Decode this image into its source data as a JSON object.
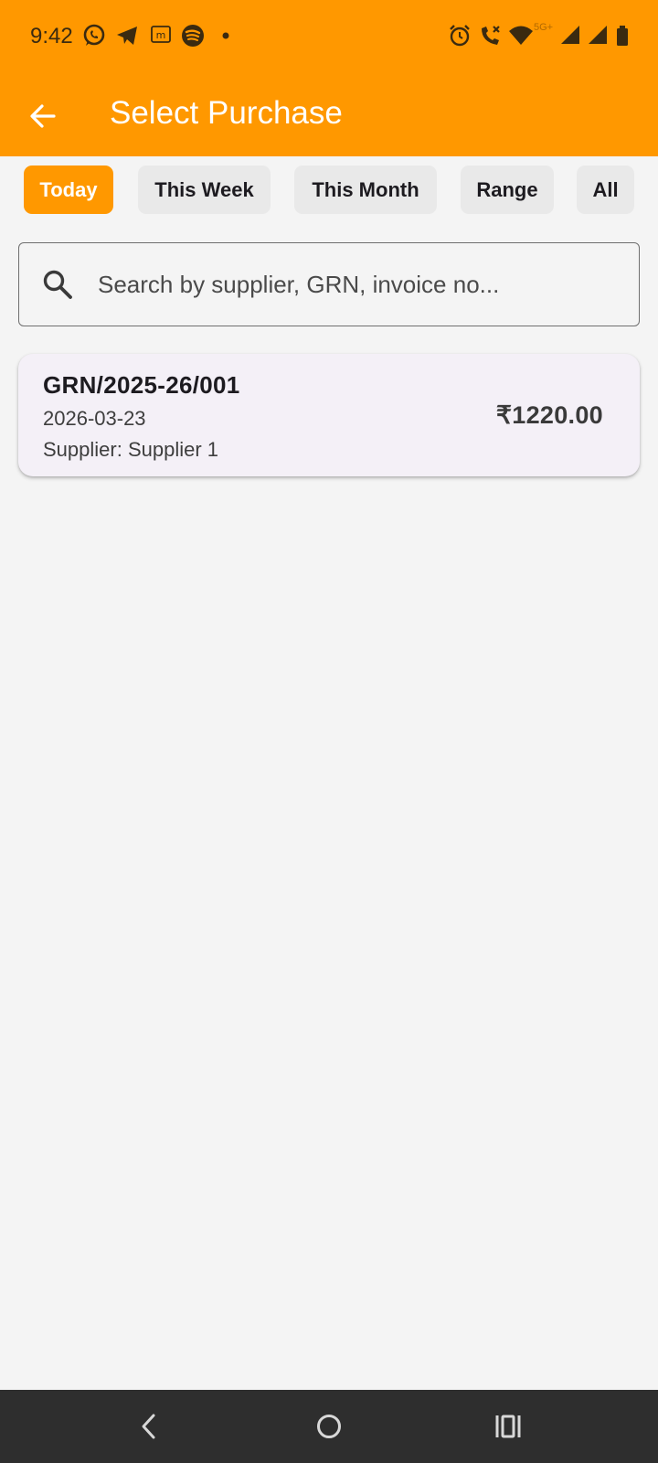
{
  "status_bar": {
    "time": "9:42",
    "left_icons": [
      "whatsapp-icon",
      "telegram-icon",
      "m-app-icon",
      "spotify-icon",
      "notification-dot-icon"
    ],
    "right_icons": [
      "alarm-icon",
      "wifi-calling-icon",
      "wifi-icon",
      "signal-icon",
      "signal-icon-2",
      "battery-icon"
    ],
    "network_label": "5G+"
  },
  "app_bar": {
    "title": "Select Purchase",
    "back_icon": "arrow-left-icon"
  },
  "filters": {
    "chips": [
      {
        "label": "Today",
        "active": true
      },
      {
        "label": "This Week",
        "active": false
      },
      {
        "label": "This Month",
        "active": false
      },
      {
        "label": "Range",
        "active": false
      },
      {
        "label": "All",
        "active": false
      }
    ]
  },
  "search": {
    "placeholder": "Search by supplier, GRN, invoice no...",
    "value": ""
  },
  "purchases": [
    {
      "grn": "GRN/2025-26/001",
      "date": "2026-03-23",
      "supplier": "Supplier: Supplier 1",
      "amount": "₹1220.00"
    }
  ],
  "nav_bar": {
    "buttons": [
      "back-nav-icon",
      "home-nav-icon",
      "recents-nav-icon"
    ]
  },
  "colors": {
    "accent": "#ff9800",
    "background": "#f4f4f4",
    "card": "#f4f0f7",
    "nav_bar": "#2e2e2e"
  }
}
